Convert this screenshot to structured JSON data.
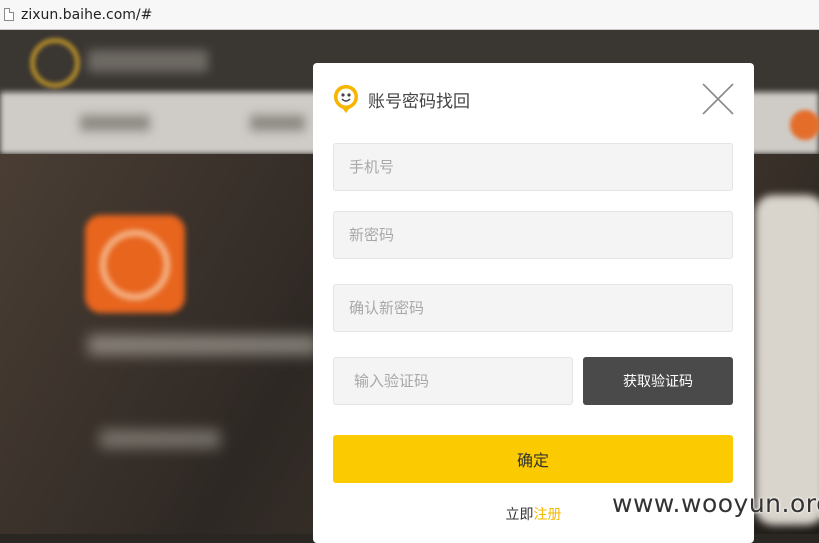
{
  "browser": {
    "url": "zixun.baihe.com/#"
  },
  "modal": {
    "title": "账号密码找回",
    "fields": {
      "phone_placeholder": "手机号",
      "new_password_placeholder": "新密码",
      "confirm_password_placeholder": "确认新密码",
      "code_placeholder": "输入验证码"
    },
    "get_code_label": "获取验证码",
    "confirm_label": "确定",
    "register_prefix": "立即",
    "register_link": "注册"
  },
  "watermark": "www.wooyun.org",
  "colors": {
    "accent": "#fcca00",
    "dark_button": "#4a4a4a",
    "link": "#f5b800"
  },
  "icons": {
    "logo": "smile-logo-icon",
    "close": "close-icon",
    "page": "page-icon"
  }
}
